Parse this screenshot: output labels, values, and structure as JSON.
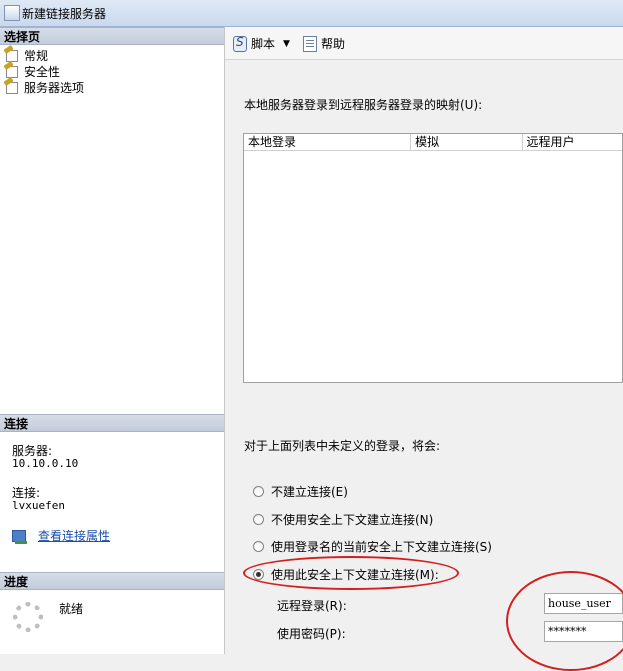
{
  "window": {
    "title": "新建链接服务器"
  },
  "left_panel": {
    "select_page_header": "选择页",
    "pages": [
      "常规",
      "安全性",
      "服务器选项"
    ],
    "connection_header": "连接",
    "server_label": "服务器:",
    "server_value": "10.10.0.10",
    "connection_label": "连接:",
    "connection_value": "lvxuefen",
    "view_connection_props": "查看连接属性",
    "progress_header": "进度",
    "progress_status": "就绪"
  },
  "toolbar": {
    "script_label": "脚本",
    "help_label": "帮助"
  },
  "security": {
    "mapping_label": "本地服务器登录到远程服务器登录的映射(U):",
    "table_headers": [
      "本地登录",
      "模拟",
      "远程用户"
    ],
    "undefined_label": "对于上面列表中未定义的登录，将会:",
    "options": [
      {
        "label": "不建立连接(E)",
        "checked": false
      },
      {
        "label": "不使用安全上下文建立连接(N)",
        "checked": false
      },
      {
        "label": "使用登录名的当前安全上下文建立连接(S)",
        "checked": false
      },
      {
        "label": "使用此安全上下文建立连接(M):",
        "checked": true
      }
    ],
    "remote_login_label": "远程登录(R):",
    "remote_login_value": "house_user",
    "password_label": "使用密码(P):",
    "password_value": "*******"
  },
  "colors": {
    "annotation_red": "#d41f1f",
    "link_blue": "#1a4ea8"
  }
}
